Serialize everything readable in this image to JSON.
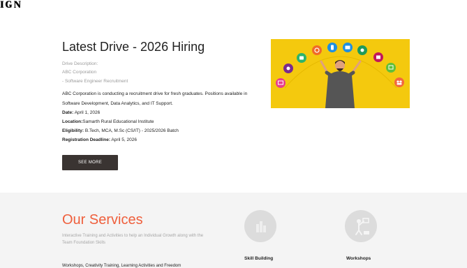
{
  "brand_fragment": "ɪɢɴ",
  "drive": {
    "title": "Latest Drive - 2026 Hiring",
    "muted_lines": [
      "Drive Description:",
      "ABC Corporation",
      "- Software Engineer Recruitment"
    ],
    "description_line1": "ABC Corporation is conducting a recruitment drive for fresh graduates. Positions available in",
    "description_line2": "Software Development, Data Analytics, and IT Support.",
    "date_label": "Date:",
    "date_value": " April 1, 2026",
    "location_label": "Location:",
    "location_value": "Samarth Rural Educational Institute",
    "eligibility_label": "Eligibility:",
    "eligibility_value": " B.Tech, MCA, M.Sc (CS/IT) - 2025/2026 Batch",
    "deadline_label": "Registration Deadline:",
    "deadline_value": " April 5, 2026",
    "see_more_label": "SEE MORE",
    "image_colors": {
      "background": "#f4c90e",
      "person_shirt": "#555555",
      "skin": "#e0a17d"
    }
  },
  "services": {
    "title": "Our Services",
    "subtitle": "Interactive Training and Activities to help an Individual Growth along with the Team Foundation Skills",
    "cut_line": "Workshops, Creativity Training, Learning Activities and Freedom",
    "items": [
      {
        "label": "Skill Building",
        "icon": "skill-building-icon"
      },
      {
        "label": "Workshops",
        "icon": "workshop-icon"
      }
    ],
    "accent_color": "#ef5f3c"
  }
}
